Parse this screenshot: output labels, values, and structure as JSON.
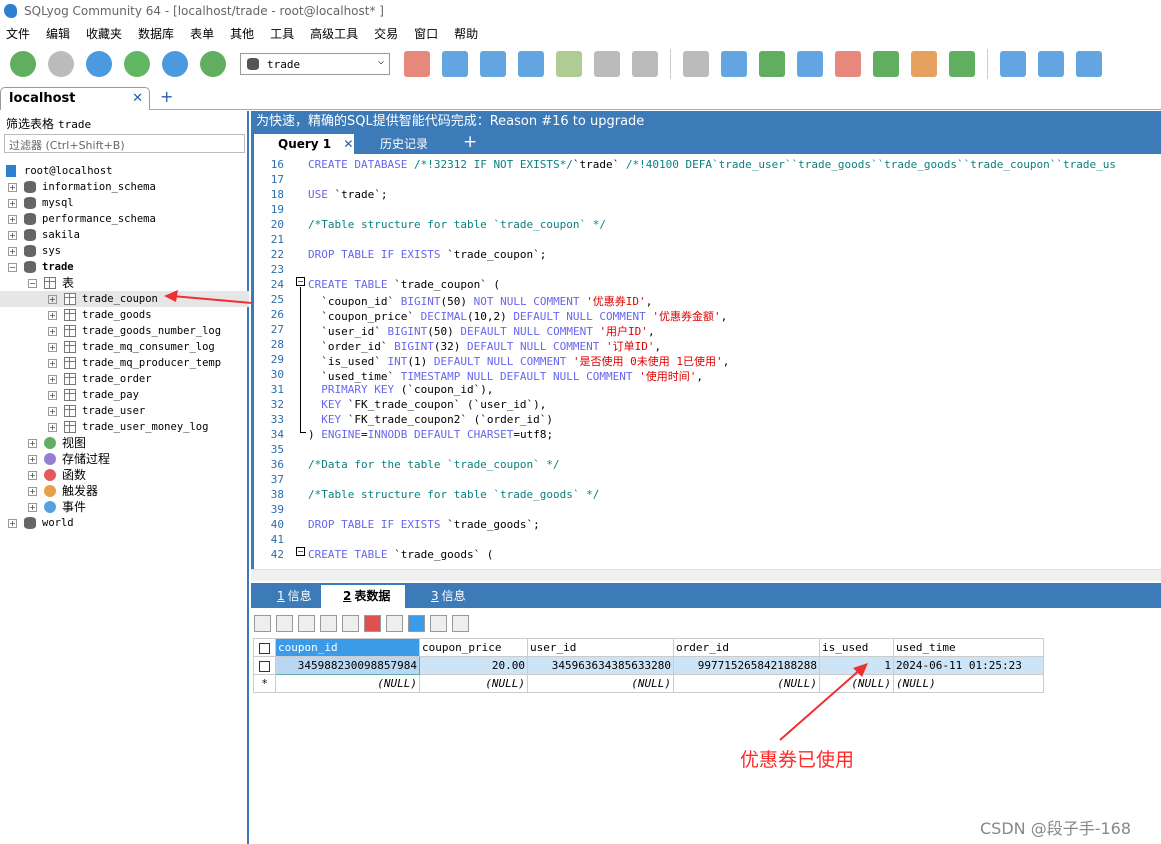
{
  "window": {
    "title": "SQLyog Community 64 - [localhost/trade - root@localhost* ]"
  },
  "menu": [
    "文件",
    "编辑",
    "收藏夹",
    "数据库",
    "表单",
    "其他",
    "工具",
    "高级工具",
    "交易",
    "窗口",
    "帮助"
  ],
  "toolbar": {
    "database_select": "trade"
  },
  "connection_tab": {
    "label": "localhost",
    "close": "✕",
    "add": "+"
  },
  "left": {
    "filter_label": "筛选表格",
    "filter_value": "trade",
    "filter_placeholder": "过滤器 (Ctrl+Shift+B)",
    "tree": [
      {
        "label": "root@localhost",
        "level": 0,
        "type": "server"
      },
      {
        "label": "information_schema",
        "level": 0,
        "type": "db"
      },
      {
        "label": "mysql",
        "level": 0,
        "type": "db"
      },
      {
        "label": "performance_schema",
        "level": 0,
        "type": "db"
      },
      {
        "label": "sakila",
        "level": 0,
        "type": "db"
      },
      {
        "label": "sys",
        "level": 0,
        "type": "db"
      },
      {
        "label": "trade",
        "level": 0,
        "type": "db",
        "open": true,
        "bold": true
      },
      {
        "label": "表",
        "level": 1,
        "type": "folder",
        "open": true
      },
      {
        "label": "trade_coupon",
        "level": 2,
        "type": "table",
        "selected": true
      },
      {
        "label": "trade_goods",
        "level": 2,
        "type": "table"
      },
      {
        "label": "trade_goods_number_log",
        "level": 2,
        "type": "table"
      },
      {
        "label": "trade_mq_consumer_log",
        "level": 2,
        "type": "table"
      },
      {
        "label": "trade_mq_producer_temp",
        "level": 2,
        "type": "table"
      },
      {
        "label": "trade_order",
        "level": 2,
        "type": "table"
      },
      {
        "label": "trade_pay",
        "level": 2,
        "type": "table"
      },
      {
        "label": "trade_user",
        "level": 2,
        "type": "table"
      },
      {
        "label": "trade_user_money_log",
        "level": 2,
        "type": "table"
      },
      {
        "label": "视图",
        "level": 1,
        "type": "views"
      },
      {
        "label": "存储过程",
        "level": 1,
        "type": "procs"
      },
      {
        "label": "函数",
        "level": 1,
        "type": "funcs"
      },
      {
        "label": "触发器",
        "level": 1,
        "type": "triggers"
      },
      {
        "label": "事件",
        "level": 1,
        "type": "events"
      },
      {
        "label": "world",
        "level": 0,
        "type": "db"
      }
    ]
  },
  "editor": {
    "hint": "为快速，精确的SQL提供智能代码完成：Reason #16 to upgrade",
    "tabs": [
      {
        "label": "Query 1",
        "close": "✕"
      },
      {
        "label": "历史记录"
      }
    ],
    "add": "+",
    "lines": [
      {
        "n": "16",
        "seg": [
          [
            "CREATE DATABASE ",
            "kw"
          ],
          [
            "/*!32312 IF NOT EXISTS*/",
            "cm"
          ],
          [
            "`trade` ",
            "pl"
          ],
          [
            "/*!40100 DEFA`trade_user``trade_goods``trade_goods``trade_coupon``trade_us",
            "cm"
          ]
        ]
      },
      {
        "n": "17",
        "seg": []
      },
      {
        "n": "18",
        "seg": [
          [
            "USE ",
            "kw"
          ],
          [
            "`trade`;",
            "pl"
          ]
        ]
      },
      {
        "n": "19",
        "seg": []
      },
      {
        "n": "20",
        "seg": [
          [
            "/*Table structure for table `trade_coupon` */",
            "cm"
          ]
        ]
      },
      {
        "n": "21",
        "seg": []
      },
      {
        "n": "22",
        "seg": [
          [
            "DROP TABLE IF EXISTS ",
            "kw"
          ],
          [
            "`trade_coupon`;",
            "pl"
          ]
        ]
      },
      {
        "n": "23",
        "seg": []
      },
      {
        "n": "24",
        "seg": [
          [
            "CREATE TABLE ",
            "kw"
          ],
          [
            "`trade_coupon` (",
            "pl"
          ]
        ]
      },
      {
        "n": "25",
        "seg": [
          [
            "  `coupon_id` ",
            "pl"
          ],
          [
            "BIGINT",
            "kw"
          ],
          [
            "(50) ",
            "pl"
          ],
          [
            "NOT NULL COMMENT ",
            "kw"
          ],
          [
            "'优惠券ID'",
            "st"
          ],
          [
            ",",
            "pl"
          ]
        ]
      },
      {
        "n": "26",
        "seg": [
          [
            "  `coupon_price` ",
            "pl"
          ],
          [
            "DECIMAL",
            "kw"
          ],
          [
            "(10,2) ",
            "pl"
          ],
          [
            "DEFAULT NULL COMMENT ",
            "kw"
          ],
          [
            "'优惠券金额'",
            "st"
          ],
          [
            ",",
            "pl"
          ]
        ]
      },
      {
        "n": "27",
        "seg": [
          [
            "  `user_id` ",
            "pl"
          ],
          [
            "BIGINT",
            "kw"
          ],
          [
            "(50) ",
            "pl"
          ],
          [
            "DEFAULT NULL COMMENT ",
            "kw"
          ],
          [
            "'用户ID'",
            "st"
          ],
          [
            ",",
            "pl"
          ]
        ]
      },
      {
        "n": "28",
        "seg": [
          [
            "  `order_id` ",
            "pl"
          ],
          [
            "BIGINT",
            "kw"
          ],
          [
            "(32) ",
            "pl"
          ],
          [
            "DEFAULT NULL COMMENT ",
            "kw"
          ],
          [
            "'订单ID'",
            "st"
          ],
          [
            ",",
            "pl"
          ]
        ]
      },
      {
        "n": "29",
        "seg": [
          [
            "  `is_used` ",
            "pl"
          ],
          [
            "INT",
            "kw"
          ],
          [
            "(1) ",
            "pl"
          ],
          [
            "DEFAULT NULL COMMENT ",
            "kw"
          ],
          [
            "'是否使用 0未使用 1已使用'",
            "st"
          ],
          [
            ",",
            "pl"
          ]
        ]
      },
      {
        "n": "30",
        "seg": [
          [
            "  `used_time` ",
            "pl"
          ],
          [
            "TIMESTAMP NULL DEFAULT NULL COMMENT ",
            "kw"
          ],
          [
            "'使用时间'",
            "st"
          ],
          [
            ",",
            "pl"
          ]
        ]
      },
      {
        "n": "31",
        "seg": [
          [
            "  PRIMARY KEY ",
            "kw"
          ],
          [
            "(`coupon_id`),",
            "pl"
          ]
        ]
      },
      {
        "n": "32",
        "seg": [
          [
            "  KEY ",
            "kw"
          ],
          [
            "`FK_trade_coupon` (`user_id`),",
            "pl"
          ]
        ]
      },
      {
        "n": "33",
        "seg": [
          [
            "  KEY ",
            "kw"
          ],
          [
            "`FK_trade_coupon2` (`order_id`)",
            "pl"
          ]
        ]
      },
      {
        "n": "34",
        "seg": [
          [
            ") ",
            "pl"
          ],
          [
            "ENGINE",
            "kw"
          ],
          [
            "=",
            "pl"
          ],
          [
            "INNODB DEFAULT CHARSET",
            "kw"
          ],
          [
            "=utf8;",
            "pl"
          ]
        ]
      },
      {
        "n": "35",
        "seg": []
      },
      {
        "n": "36",
        "seg": [
          [
            "/*Data for the table `trade_coupon` */",
            "cm"
          ]
        ]
      },
      {
        "n": "37",
        "seg": []
      },
      {
        "n": "38",
        "seg": [
          [
            "/*Table structure for table `trade_goods` */",
            "cm"
          ]
        ]
      },
      {
        "n": "39",
        "seg": []
      },
      {
        "n": "40",
        "seg": [
          [
            "DROP TABLE IF EXISTS ",
            "kw"
          ],
          [
            "`trade_goods`;",
            "pl"
          ]
        ]
      },
      {
        "n": "41",
        "seg": []
      },
      {
        "n": "42",
        "seg": [
          [
            "CREATE TABLE ",
            "kw"
          ],
          [
            "`trade_goods` (",
            "pl"
          ]
        ]
      }
    ]
  },
  "results": {
    "tabs": [
      {
        "num": "1",
        "label": "信息"
      },
      {
        "num": "2",
        "label": "表数据"
      },
      {
        "num": "3",
        "label": "信息"
      }
    ],
    "columns": [
      "coupon_id",
      "coupon_price",
      "user_id",
      "order_id",
      "is_used",
      "used_time"
    ],
    "rows": [
      [
        "345988230098857984",
        "20.00",
        "345963634385633280",
        "997715265842188288",
        "1",
        "2024-06-11 01:25:23"
      ]
    ],
    "new_row_marker": "*",
    "null_text": "(NULL)"
  },
  "annotation": "优惠券已使用",
  "watermark": "CSDN @段子手-168"
}
